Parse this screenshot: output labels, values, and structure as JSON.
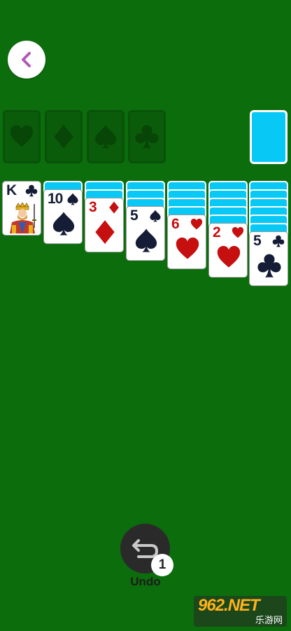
{
  "colors": {
    "table_green": "#0c6d0c",
    "card_back": "#08c8f5",
    "red_suit": "#c60f0f",
    "black_suit": "#151c36",
    "back_chevron": "#b05ab8"
  },
  "header": {
    "back_icon": "chevron-left-icon"
  },
  "foundations": [
    {
      "suit": "hearts"
    },
    {
      "suit": "diamonds"
    },
    {
      "suit": "spades"
    },
    {
      "suit": "clubs"
    }
  ],
  "stock": {
    "state": "face-down"
  },
  "tableau": [
    {
      "face_down": 0,
      "face_up": [
        {
          "rank": "K",
          "suit": "clubs",
          "face_card": "king"
        }
      ]
    },
    {
      "face_down": 1,
      "face_up": [
        {
          "rank": "10",
          "suit": "spades"
        }
      ]
    },
    {
      "face_down": 2,
      "face_up": [
        {
          "rank": "3",
          "suit": "diamonds"
        }
      ]
    },
    {
      "face_down": 3,
      "face_up": [
        {
          "rank": "5",
          "suit": "spades"
        }
      ]
    },
    {
      "face_down": 4,
      "face_up": [
        {
          "rank": "6",
          "suit": "hearts"
        }
      ]
    },
    {
      "face_down": 5,
      "face_up": [
        {
          "rank": "2",
          "suit": "hearts"
        }
      ]
    },
    {
      "face_down": 6,
      "face_up": [
        {
          "rank": "5",
          "suit": "clubs"
        }
      ]
    }
  ],
  "undo": {
    "label": "Undo",
    "count": "1",
    "icon": "undo-arrow-icon"
  },
  "watermark": {
    "main": "962.NET",
    "sub": "乐游网"
  }
}
